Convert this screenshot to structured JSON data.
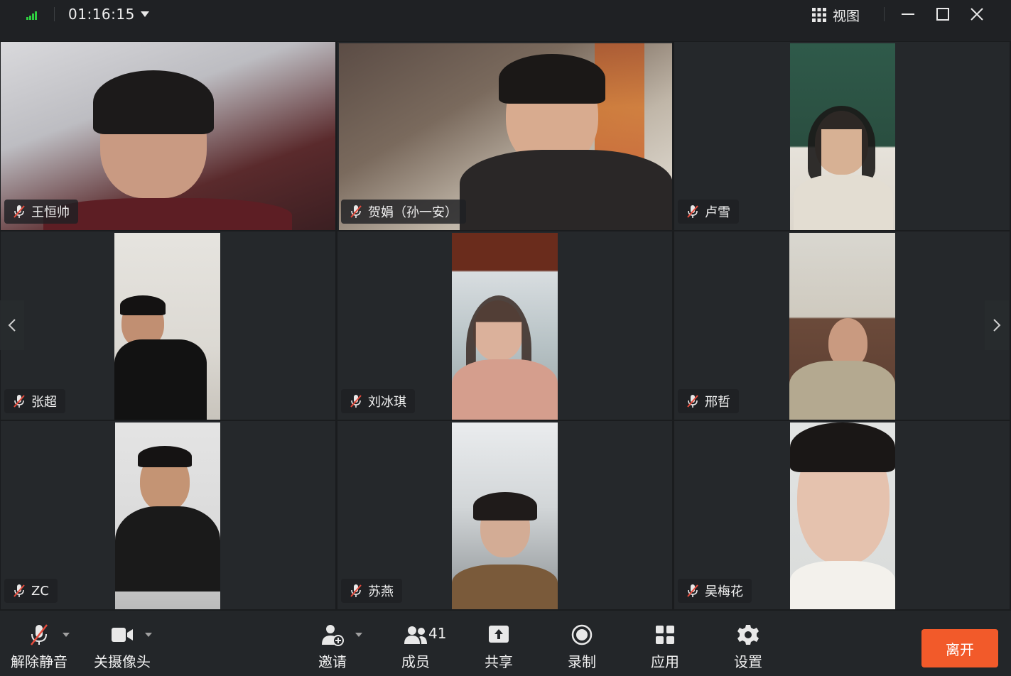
{
  "titlebar": {
    "timer": "01:16:15",
    "view_label": "视图"
  },
  "participants": [
    {
      "name": "王恒帅",
      "muted": true
    },
    {
      "name": "贺娟（孙一安）",
      "muted": true
    },
    {
      "name": "卢雪",
      "muted": true
    },
    {
      "name": "张超",
      "muted": true
    },
    {
      "name": "刘冰琪",
      "muted": true
    },
    {
      "name": "邢哲",
      "muted": true
    },
    {
      "name": "ZC",
      "muted": true
    },
    {
      "name": "苏燕",
      "muted": true
    },
    {
      "name": "吴梅花",
      "muted": true
    }
  ],
  "toolbar": {
    "unmute_label": "解除静音",
    "camera_label": "关摄像头",
    "invite_label": "邀请",
    "members_label": "成员",
    "member_count": "41",
    "share_label": "共享",
    "record_label": "录制",
    "apps_label": "应用",
    "settings_label": "设置",
    "leave_label": "离开"
  },
  "colors": {
    "accent_leave": "#f25a2a",
    "signal": "#2ecc40",
    "mute_red": "#e64b3c"
  }
}
